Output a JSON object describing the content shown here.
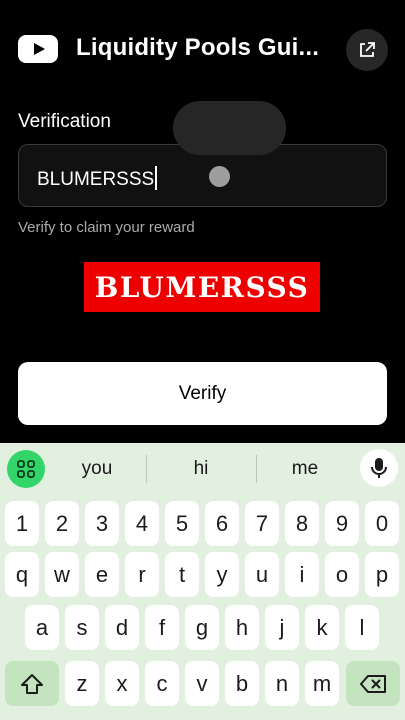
{
  "header": {
    "title": "Liquidity Pools Gui...",
    "logo_icon": "youtube-logo-icon",
    "external_icon": "open-external-icon"
  },
  "form": {
    "label": "Verification",
    "input_value": "BLUMERSSS",
    "hint": "Verify to claim your reward",
    "captcha_text": "BLUMERSSS",
    "button_label": "Verify"
  },
  "keyboard": {
    "suggestions": [
      "you",
      "hi",
      "me"
    ],
    "number_row": [
      "1",
      "2",
      "3",
      "4",
      "5",
      "6",
      "7",
      "8",
      "9",
      "0"
    ],
    "row1": [
      "q",
      "w",
      "e",
      "r",
      "t",
      "y",
      "u",
      "i",
      "o",
      "p"
    ],
    "row2": [
      "a",
      "s",
      "d",
      "f",
      "g",
      "h",
      "j",
      "k",
      "l"
    ],
    "row3": [
      "z",
      "x",
      "c",
      "v",
      "b",
      "n",
      "m"
    ],
    "icons": [
      "apps-grid-icon",
      "microphone-icon",
      "shift-icon",
      "backspace-icon"
    ]
  },
  "colors": {
    "background": "#000000",
    "captcha_bg": "#ee0000",
    "keyboard_bg": "#e2f0df",
    "accent_green": "#33d46a"
  }
}
